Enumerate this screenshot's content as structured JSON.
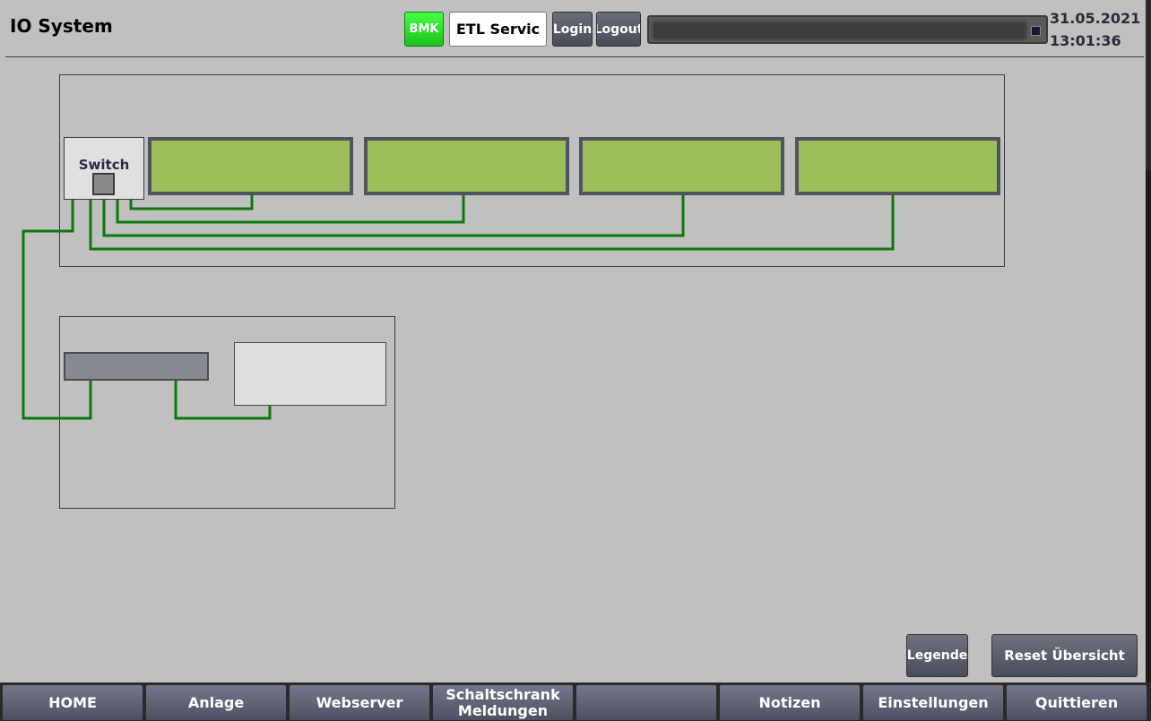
{
  "header": {
    "title": "IO System",
    "bmk_label": "BMK",
    "etl_label": "ETL Servic",
    "login_label": "Login",
    "logout_label": "Logout",
    "alarm_text": "",
    "date": "31.05.2021",
    "time": "13:01:36"
  },
  "groups": [
    {
      "title": ""
    },
    {
      "title": ""
    }
  ],
  "switch": {
    "label": "Switch"
  },
  "devices": [
    {
      "label": ""
    },
    {
      "label": ""
    },
    {
      "label": ""
    },
    {
      "label": ""
    },
    {
      "label": ""
    },
    {
      "label": ""
    }
  ],
  "actions": {
    "legende": "Legende",
    "reset": "Reset Übersicht"
  },
  "nav": [
    {
      "label": "HOME"
    },
    {
      "label": "Anlage"
    },
    {
      "label": "Webserver"
    },
    {
      "label": "Schaltschrank\nMeldungen"
    },
    {
      "label": ""
    },
    {
      "label": "Notizen"
    },
    {
      "label": "Einstellungen"
    },
    {
      "label": "Quittieren"
    }
  ],
  "colors": {
    "background": "#c0c0c0",
    "device_ok": "#9cbf5c",
    "wire": "#0a7a0a",
    "bmk_active": "#22dd22",
    "alarm_text": "#ff2020"
  }
}
